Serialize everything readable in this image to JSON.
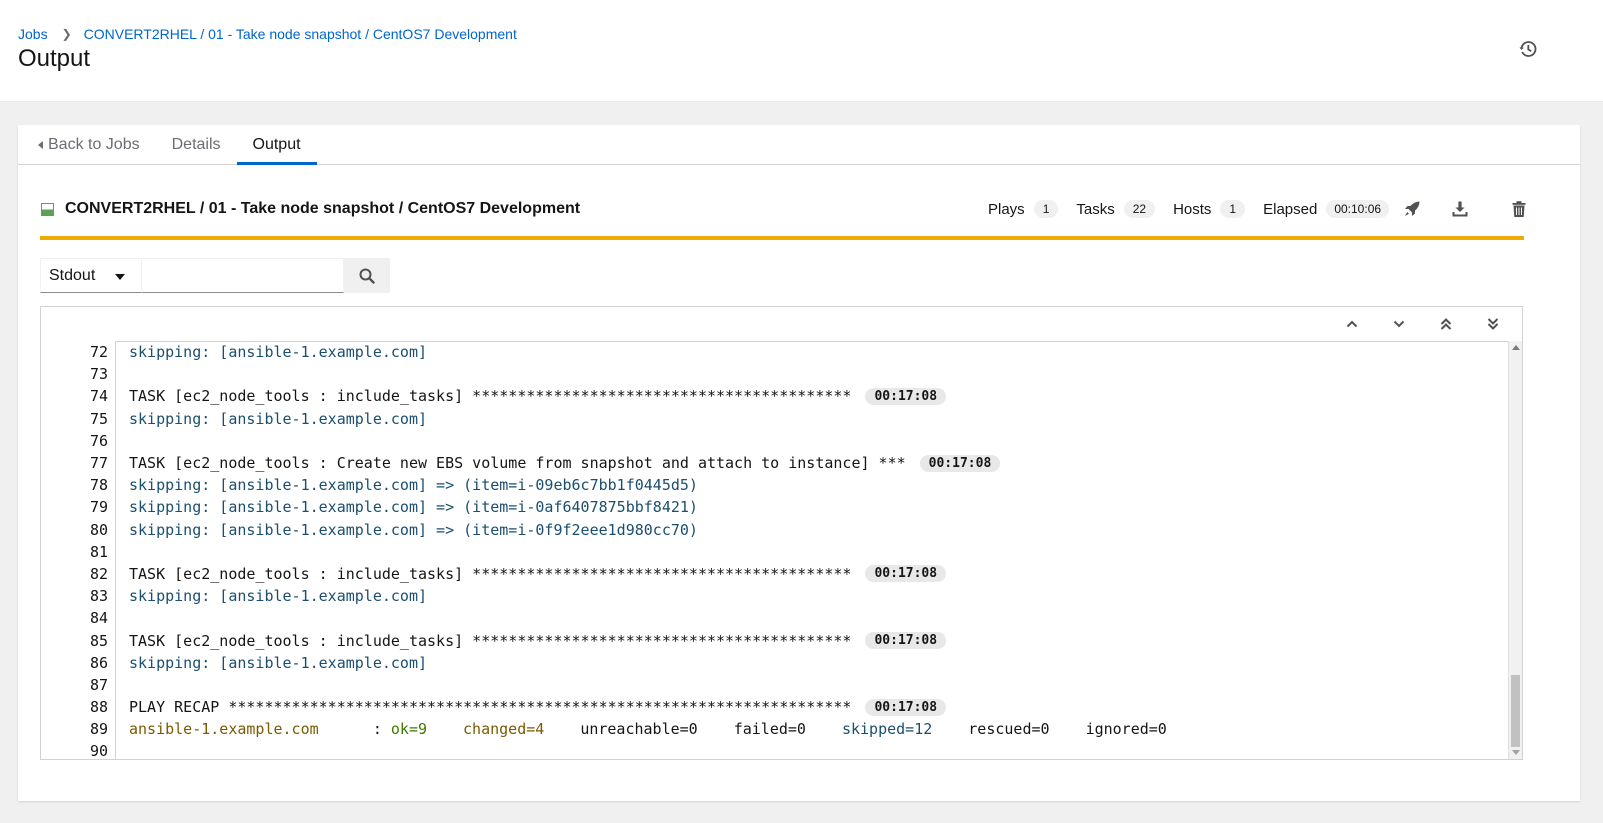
{
  "breadcrumb": {
    "jobs": "Jobs",
    "current": "CONVERT2RHEL / 01 - Take node snapshot / CentOS7 Development"
  },
  "page_title": "Output",
  "tabs": {
    "back": "Back to Jobs",
    "details": "Details",
    "output": "Output"
  },
  "job": {
    "title": "CONVERT2RHEL / 01 - Take node snapshot / CentOS7 Development",
    "status": "successful",
    "plays_label": "Plays",
    "plays": "1",
    "tasks_label": "Tasks",
    "tasks": "22",
    "hosts_label": "Hosts",
    "hosts": "1",
    "elapsed_label": "Elapsed",
    "elapsed": "00:10:06"
  },
  "search": {
    "select_value": "Stdout",
    "placeholder": ""
  },
  "output": {
    "lines": [
      {
        "n": "72",
        "text": "skipping: [ansible-1.example.com]",
        "style": "blue"
      },
      {
        "n": "73",
        "text": ""
      },
      {
        "n": "74",
        "text": "TASK [ec2_node_tools : include_tasks] ******************************************",
        "time": "00:17:08"
      },
      {
        "n": "75",
        "text": "skipping: [ansible-1.example.com]",
        "style": "blue"
      },
      {
        "n": "76",
        "text": ""
      },
      {
        "n": "77",
        "text": "TASK [ec2_node_tools : Create new EBS volume from snapshot and attach to instance] ***",
        "time": "00:17:08"
      },
      {
        "n": "78",
        "text": "skipping: [ansible-1.example.com] => (item=i-09eb6c7bb1f0445d5)",
        "style": "blue"
      },
      {
        "n": "79",
        "text": "skipping: [ansible-1.example.com] => (item=i-0af6407875bbf8421)",
        "style": "blue"
      },
      {
        "n": "80",
        "text": "skipping: [ansible-1.example.com] => (item=i-0f9f2eee1d980cc70)",
        "style": "blue"
      },
      {
        "n": "81",
        "text": ""
      },
      {
        "n": "82",
        "text": "TASK [ec2_node_tools : include_tasks] ******************************************",
        "time": "00:17:08"
      },
      {
        "n": "83",
        "text": "skipping: [ansible-1.example.com]",
        "style": "blue"
      },
      {
        "n": "84",
        "text": ""
      },
      {
        "n": "85",
        "text": "TASK [ec2_node_tools : include_tasks] ******************************************",
        "time": "00:17:08"
      },
      {
        "n": "86",
        "text": "skipping: [ansible-1.example.com]",
        "style": "blue"
      },
      {
        "n": "87",
        "text": ""
      },
      {
        "n": "88",
        "text": "PLAY RECAP *********************************************************************",
        "time": "00:17:08"
      },
      {
        "n": "89",
        "recap": {
          "host": "ansible-1.example.com",
          "sep": "      : ",
          "ok": "ok=9",
          "changed": "changed=4",
          "unreachable": "unreachable=0",
          "failed": "failed=0",
          "skipped": "skipped=12",
          "rescued": "rescued=0",
          "ignored": "ignored=0"
        }
      },
      {
        "n": "90",
        "text": ""
      }
    ]
  },
  "colors": {
    "link": "#0066cc",
    "progress": "#f0ab00",
    "status_success": "#5ba352"
  },
  "icons": {
    "history": "history-icon",
    "launch": "rocket-icon",
    "download": "download-icon",
    "delete": "trash-icon",
    "search": "search-icon"
  }
}
